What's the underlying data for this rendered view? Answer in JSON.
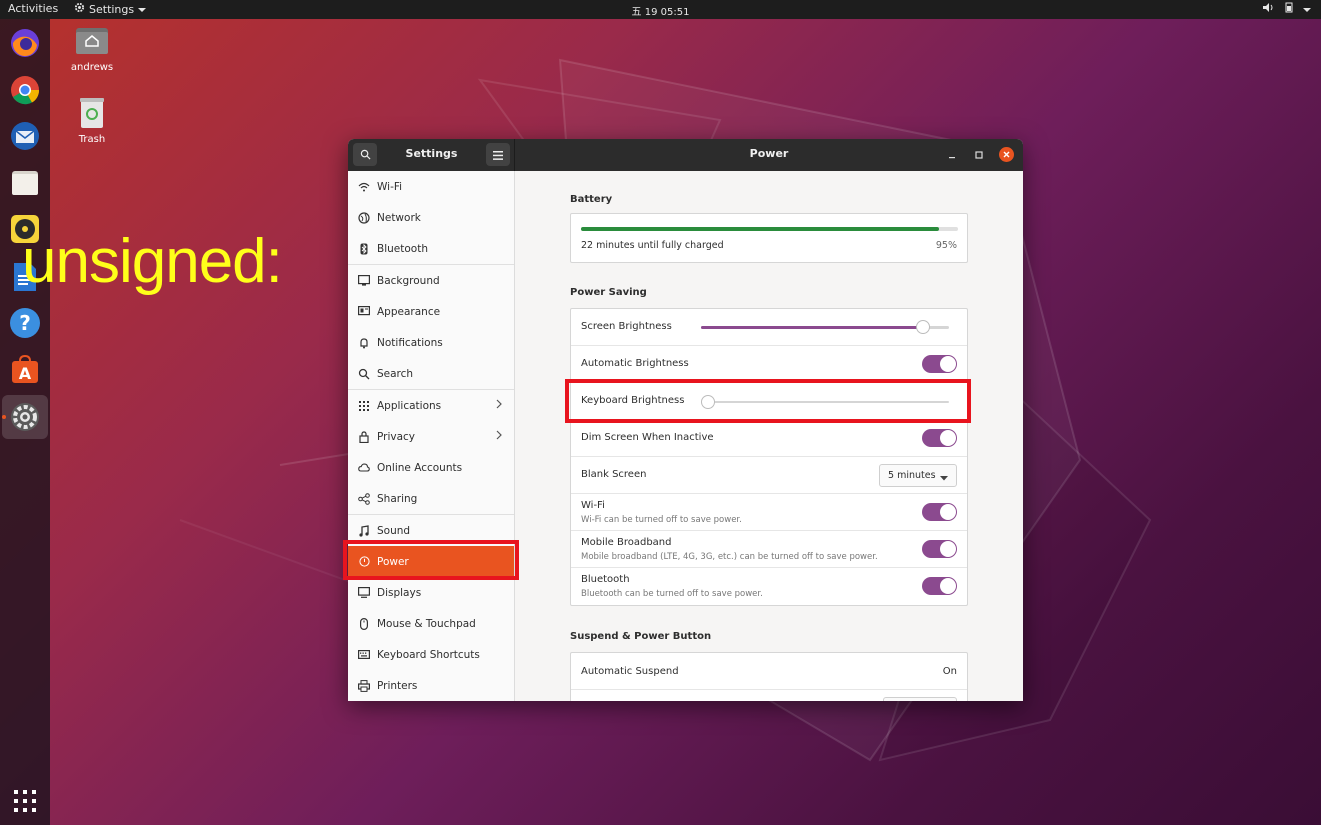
{
  "topbar": {
    "activities": "Activities",
    "app_menu": "Settings",
    "clock": "五 19 05:51"
  },
  "desktop": {
    "home_label": "andrews",
    "trash_label": "Trash"
  },
  "overlay_text": "unsigned:",
  "window": {
    "sidebar_title": "Settings",
    "page_title": "Power"
  },
  "sidebar": {
    "items": [
      {
        "label": "Wi-Fi",
        "icon": "wifi-icon"
      },
      {
        "label": "Network",
        "icon": "network-icon"
      },
      {
        "label": "Bluetooth",
        "icon": "bluetooth-icon"
      },
      {
        "label": "Background",
        "icon": "background-icon"
      },
      {
        "label": "Appearance",
        "icon": "appearance-icon"
      },
      {
        "label": "Notifications",
        "icon": "bell-icon"
      },
      {
        "label": "Search",
        "icon": "search-icon"
      },
      {
        "label": "Applications",
        "icon": "grid-icon"
      },
      {
        "label": "Privacy",
        "icon": "lock-icon"
      },
      {
        "label": "Online Accounts",
        "icon": "cloud-icon"
      },
      {
        "label": "Sharing",
        "icon": "share-icon"
      },
      {
        "label": "Sound",
        "icon": "music-icon"
      },
      {
        "label": "Power",
        "icon": "power-icon"
      },
      {
        "label": "Displays",
        "icon": "display-icon"
      },
      {
        "label": "Mouse & Touchpad",
        "icon": "mouse-icon"
      },
      {
        "label": "Keyboard Shortcuts",
        "icon": "keyboard-icon"
      },
      {
        "label": "Printers",
        "icon": "printer-icon"
      }
    ]
  },
  "battery": {
    "title": "Battery",
    "status": "22 minutes until fully charged",
    "percent_text": "95%",
    "level": 0.95
  },
  "power_saving": {
    "title": "Power Saving",
    "screen_brightness": {
      "label": "Screen Brightness",
      "value": 0.92
    },
    "automatic_brightness": {
      "label": "Automatic Brightness",
      "on": true
    },
    "keyboard_brightness": {
      "label": "Keyboard Brightness",
      "value": 0.0
    },
    "dim_screen": {
      "label": "Dim Screen When Inactive",
      "on": true
    },
    "blank_screen": {
      "label": "Blank Screen",
      "value": "5 minutes"
    },
    "wifi": {
      "label": "Wi-Fi",
      "sub": "Wi-Fi can be turned off to save power.",
      "on": true
    },
    "mobile_broadband": {
      "label": "Mobile Broadband",
      "sub": "Mobile broadband (LTE, 4G, 3G, etc.) can be turned off to save power.",
      "on": true
    },
    "bluetooth": {
      "label": "Bluetooth",
      "sub": "Bluetooth can be turned off to save power.",
      "on": true
    }
  },
  "suspend": {
    "title": "Suspend & Power Button",
    "automatic_suspend": {
      "label": "Automatic Suspend",
      "value": "On"
    }
  },
  "colors": {
    "accent": "#e95420",
    "toggle": "#8b4a8f",
    "highlight": "#e8141e",
    "overlay": "#ffff1a"
  }
}
